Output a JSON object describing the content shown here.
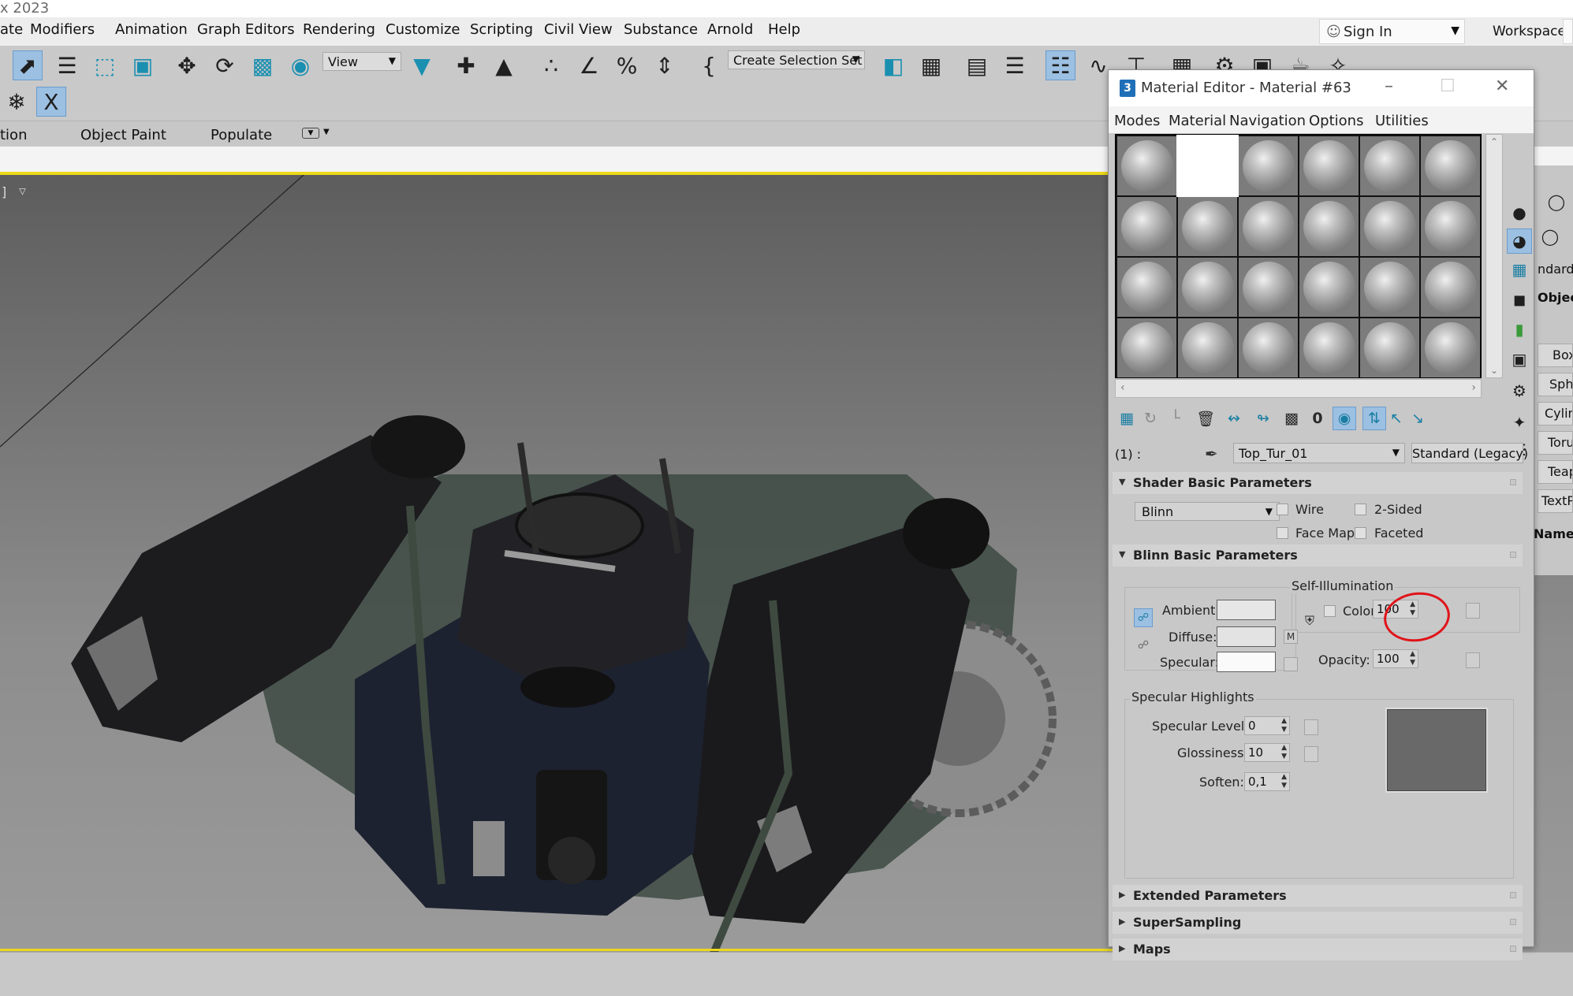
{
  "app": {
    "title_fragment": "x 2023",
    "menu": [
      "ate",
      "Modifiers",
      "Animation",
      "Graph Editors",
      "Rendering",
      "Customize",
      "Scripting",
      "Civil View",
      "Substance",
      "Arnold",
      "Help"
    ],
    "sign_in": "Sign In",
    "workspaces_label": "Workspaces:",
    "toolbar": {
      "view_dropdown": "View",
      "selection_set_dropdown": "Create Selection Set"
    },
    "ribbon": [
      "tion",
      "Object Paint",
      "Populate"
    ],
    "viewport_label": "]",
    "command_panel": {
      "items": [
        "ndard P",
        "Object",
        "Box",
        "Sphe",
        "Cylinc",
        "Toru",
        "Teap",
        "TextP",
        "Name"
      ]
    }
  },
  "material_editor": {
    "title": "Material Editor - Material #63",
    "logo": "3",
    "menu": [
      "Modes",
      "Material",
      "Navigation",
      "Options",
      "Utilities"
    ],
    "slots": {
      "rows": 4,
      "cols": 6,
      "selected_index": 1
    },
    "slot_label": "(1) :",
    "material_name": "Top_Tur_01",
    "material_type": "Standard (Legacy)",
    "shader_basic": {
      "title": "Shader Basic Parameters",
      "shader": "Blinn",
      "wire": "Wire",
      "two_sided": "2-Sided",
      "face_map": "Face Map",
      "faceted": "Faceted"
    },
    "blinn_basic": {
      "title": "Blinn Basic Parameters",
      "self_illum_title": "Self-Illumination",
      "color_label": "Color",
      "self_illum_value": "100",
      "ambient": "Ambient:",
      "diffuse": "Diffuse:",
      "specular": "Specular:",
      "m_button": "M",
      "opacity_label": "Opacity:",
      "opacity_value": "100",
      "specular_highlights": "Specular Highlights",
      "specular_level_label": "Specular Level:",
      "specular_level_value": "0",
      "glossiness_label": "Glossiness:",
      "glossiness_value": "10",
      "soften_label": "Soften:",
      "soften_value": "0,1"
    },
    "rollouts": [
      "Extended Parameters",
      "SuperSampling",
      "Maps"
    ],
    "colors": {
      "ambient": "#e6e6e6",
      "diffuse": "#e3e3e3",
      "specular": "#fafafa",
      "highlight_accent": "#9cc0e2",
      "annotation": "#e0141a"
    }
  }
}
